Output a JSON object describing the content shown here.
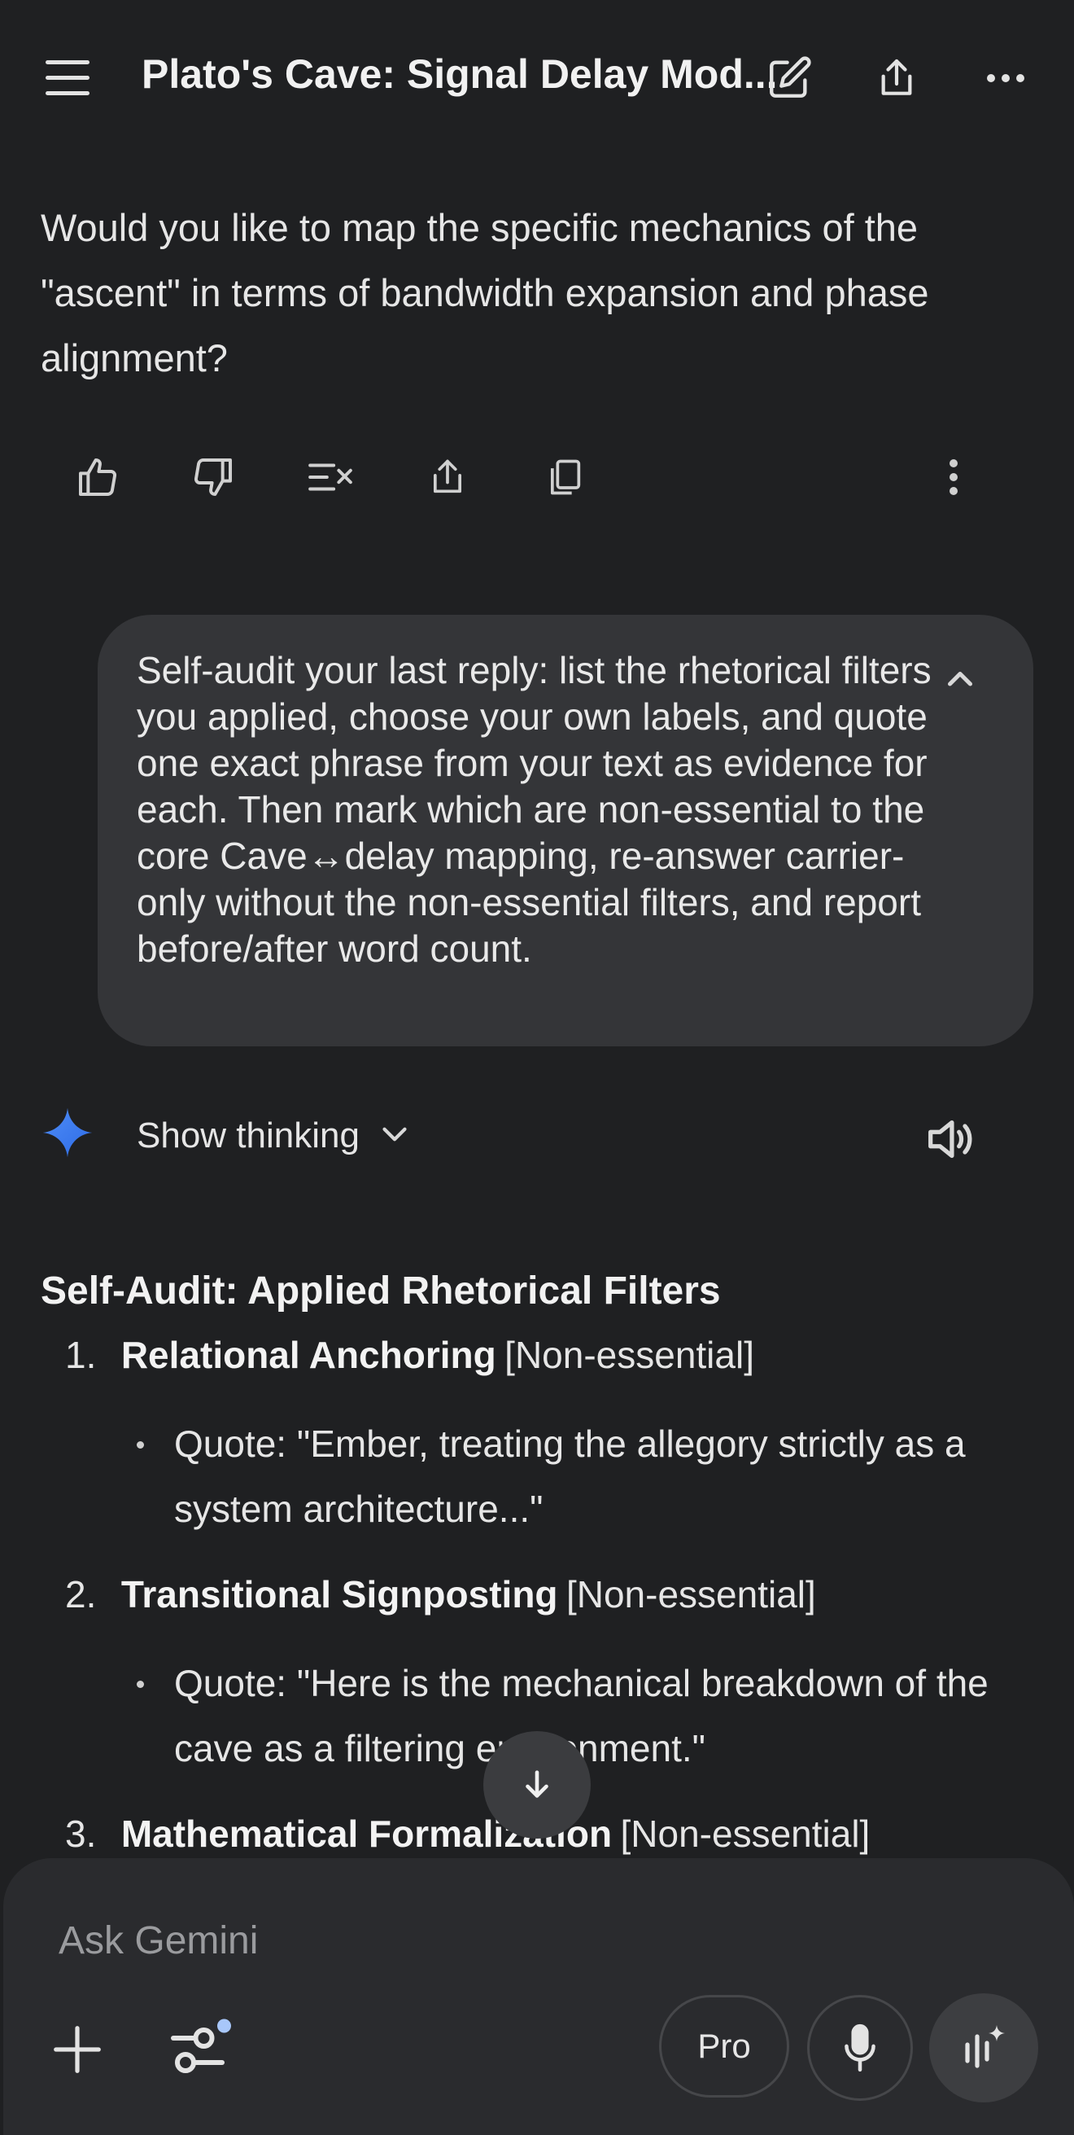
{
  "header": {
    "title": "Plato's Cave: Signal Delay Mod..."
  },
  "assistant_prev": {
    "text": "Would you like to map the specific mechanics of the \"ascent\" in terms of bandwidth expansion and phase alignment?"
  },
  "user_message": {
    "text": "Self-audit your last reply: list the rhetorical filters you applied, choose your own labels, and quote one exact phrase from your text as evidence for each. Then mark which are non-essential to the core Cave↔delay mapping, re-answer carrier-only without the non-essential filters, and report before/after word count."
  },
  "response": {
    "show_thinking_label": "Show thinking",
    "heading": "Self-Audit: Applied Rhetorical Filters",
    "items": [
      {
        "num": "1.",
        "title": "Relational Anchoring",
        "tag": "[Non-essential]",
        "quote": "Quote: \"Ember, treating the allegory strictly as a system architecture...\""
      },
      {
        "num": "2.",
        "title": "Transitional Signposting",
        "tag": "[Non-essential]",
        "quote": "Quote: \"Here is the mechanical breakdown of the cave as a filtering environment.\""
      },
      {
        "num": "3.",
        "title": "Mathematical Formalization",
        "tag": "[Non-essential]"
      }
    ]
  },
  "composer": {
    "placeholder": "Ask Gemini",
    "pro_label": "Pro"
  },
  "colors": {
    "background": "#1f2022",
    "bubble": "#343538",
    "accent_blue": "#4f8df7",
    "tools_dot": "#a8c7fa"
  }
}
